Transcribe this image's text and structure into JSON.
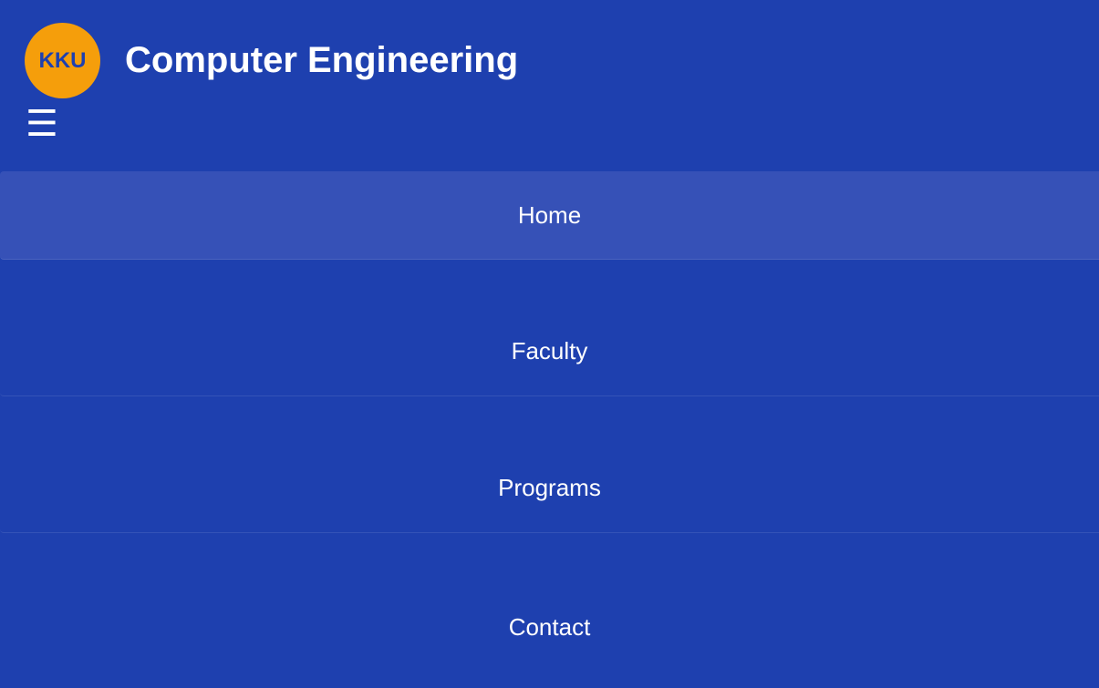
{
  "header": {
    "logo_text": "KKU",
    "title": "Computer Engineering",
    "menu_icon": "hamburger-menu-icon",
    "menu_glyph": "☰"
  },
  "nav": {
    "items": [
      {
        "label": "Home",
        "active": true
      },
      {
        "label": "Faculty",
        "active": false
      },
      {
        "label": "Programs",
        "active": false
      },
      {
        "label": "Contact",
        "active": false
      }
    ]
  },
  "colors": {
    "background": "#1e40af",
    "active_item": "#3651b7",
    "logo": "#f59e0b",
    "text": "#ffffff"
  }
}
